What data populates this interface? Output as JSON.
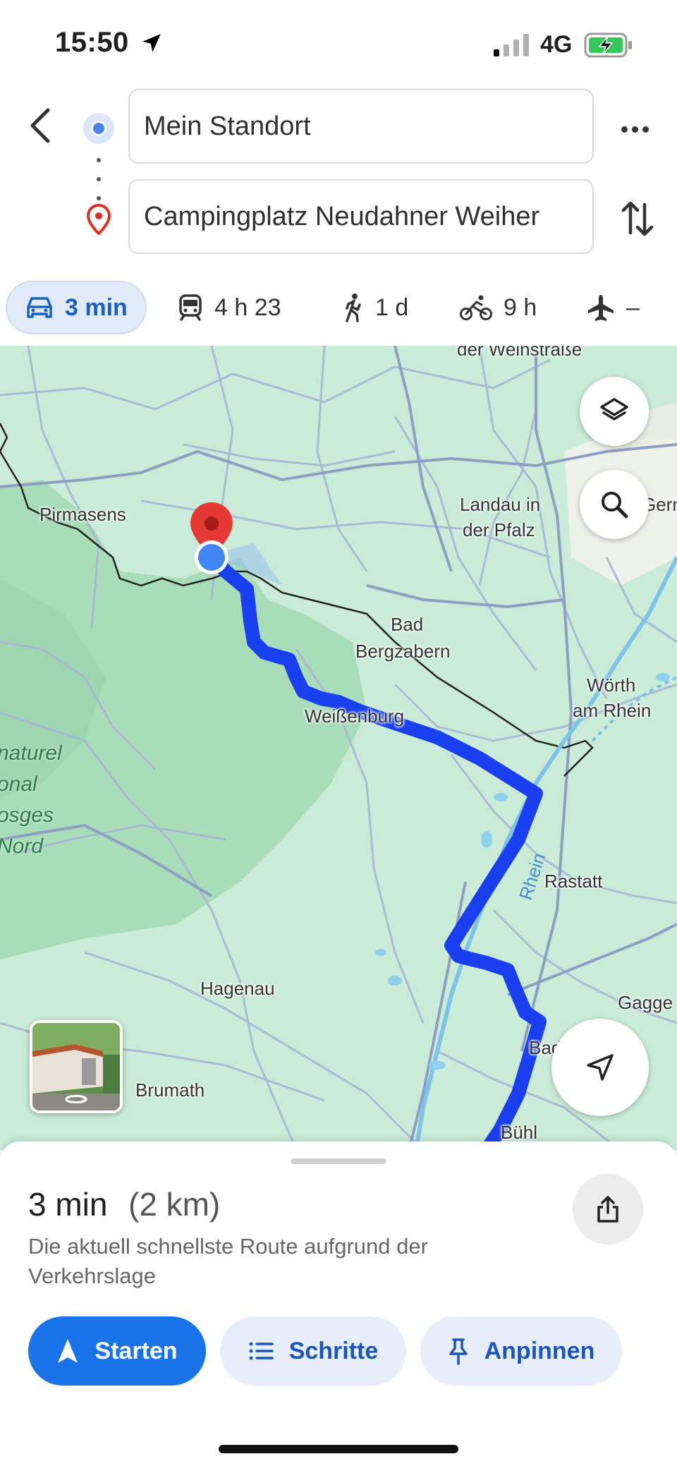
{
  "status_bar": {
    "time": "15:50",
    "network": "4G"
  },
  "search": {
    "origin": "Mein Standort",
    "destination": "Campingplatz Neudahner Weiher"
  },
  "modes": [
    {
      "icon": "car-icon",
      "label": "3 min",
      "selected": true
    },
    {
      "icon": "transit-icon",
      "label": "4 h 23"
    },
    {
      "icon": "walk-icon",
      "label": "1 d"
    },
    {
      "icon": "bike-icon",
      "label": "9 h"
    },
    {
      "icon": "flight-icon",
      "label": "–"
    }
  ],
  "map": {
    "labels": {
      "top_cut": "der Weinstraße",
      "pirmasens": "Pirmasens",
      "landau_1": "Landau in",
      "landau_2": "der Pfalz",
      "germ": "Gern",
      "bad_1": "Bad",
      "bad_2": "Bergzabern",
      "weissenburg": "Weißenburg",
      "woerth_1": "Wörth",
      "woerth_2": "am Rhein",
      "rastatt": "Rastatt",
      "rhein": "Rhein",
      "hagenau": "Hagenau",
      "gagge": "Gagge",
      "baden": "Baden-Baden",
      "brumath": "Brumath",
      "buehl": "Bühl",
      "park_1": "naturel",
      "park_2": "onal",
      "park_3": "osges",
      "park_4": "Nord"
    },
    "route_color": "#1a3ff0",
    "marker_color": "#e53935",
    "location_color": "#4285f4"
  },
  "route": {
    "duration": "3 min",
    "distance": "(2 km)",
    "description": "Die aktuell schnellste Route aufgrund der Verkehrslage"
  },
  "actions": {
    "start": "Starten",
    "steps": "Schritte",
    "pin": "Anpinnen"
  }
}
